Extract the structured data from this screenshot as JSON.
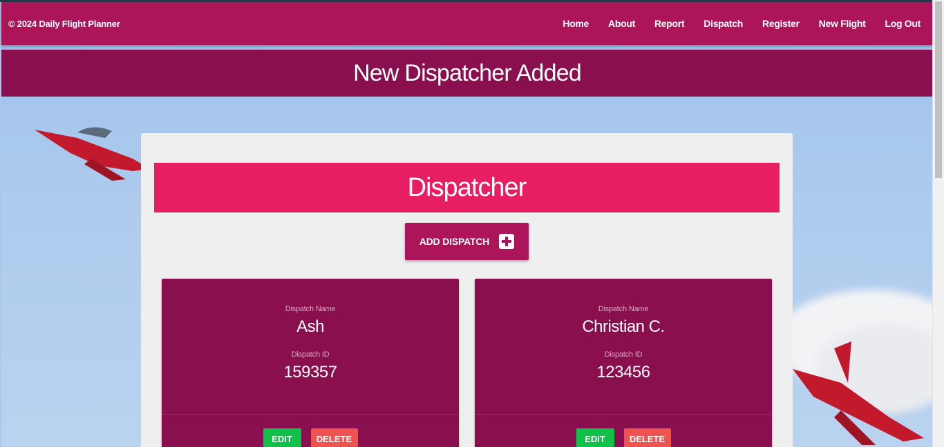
{
  "nav": {
    "brand": "© 2024 Daily Flight Planner",
    "links": [
      "Home",
      "About",
      "Report",
      "Dispatch",
      "Register",
      "New Flight",
      "Log Out"
    ]
  },
  "banner": {
    "title": "New Dispatcher Added"
  },
  "section": {
    "title": "Dispatcher",
    "add_button": "ADD DISPATCH"
  },
  "cards": [
    {
      "name_label": "Dispatch Name",
      "name": "Ash",
      "id_label": "Dispatch ID",
      "id": "159357",
      "edit_label": "EDIT",
      "delete_label": "DELETE"
    },
    {
      "name_label": "Dispatch Name",
      "name": "Christian C.",
      "id_label": "Dispatch ID",
      "id": "123456",
      "edit_label": "EDIT",
      "delete_label": "DELETE"
    }
  ],
  "colors": {
    "navbar": "#ac1559",
    "banner": "#8a0f4e",
    "section_header": "#e81e62",
    "card": "#8a0f4e",
    "edit": "#0fc049",
    "delete": "#ef5350"
  }
}
